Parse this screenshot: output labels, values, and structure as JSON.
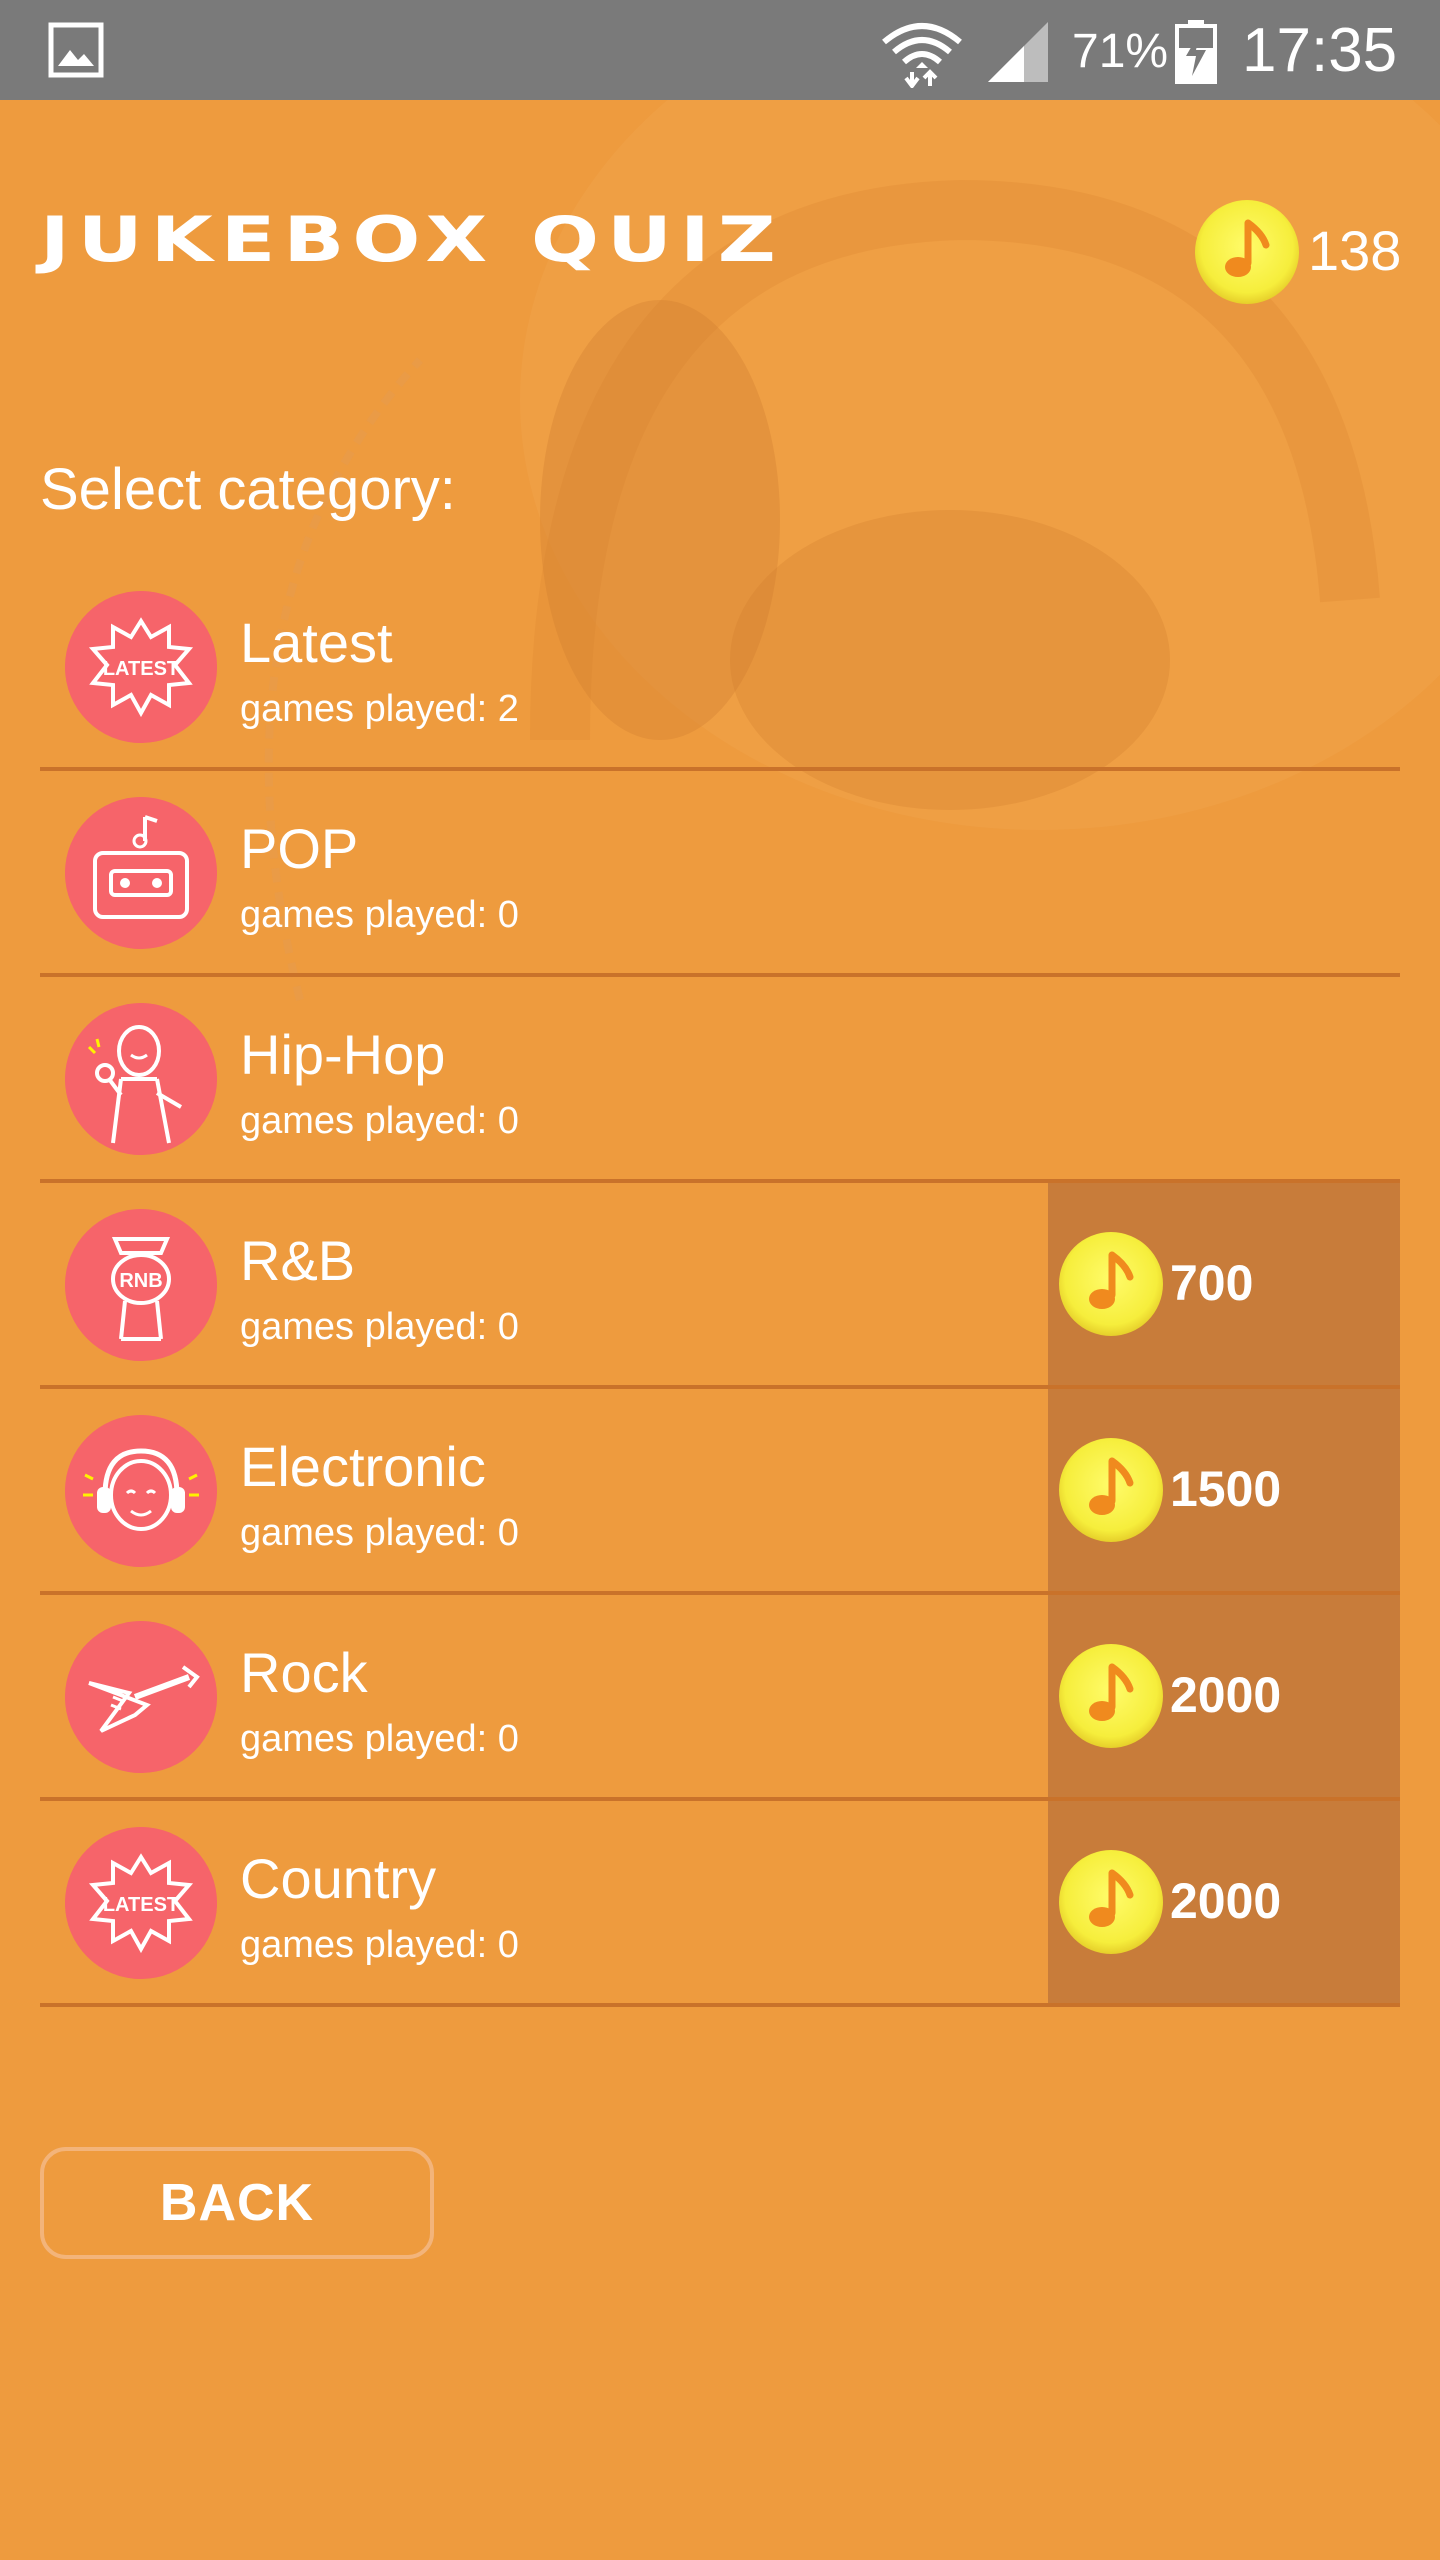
{
  "status_bar": {
    "battery_percent": "71%",
    "time": "17:35",
    "icons": [
      "gallery-icon",
      "wifi-icon",
      "signal-icon",
      "battery-charging-icon"
    ]
  },
  "header": {
    "title": "JUKEBOX QUIZ",
    "coin_balance": "138",
    "coin_icon": "music-note-coin-icon"
  },
  "section_label": "Select category:",
  "categories": [
    {
      "name": "Latest",
      "played": "games played: 2",
      "icon": "latest-badge-icon",
      "price": null
    },
    {
      "name": "POP",
      "played": "games played: 0",
      "icon": "cassette-icon",
      "price": null
    },
    {
      "name": "Hip-Hop",
      "played": "games played: 0",
      "icon": "rapper-icon",
      "price": null
    },
    {
      "name": "R&B",
      "played": "games played: 0",
      "icon": "rnb-singer-icon",
      "price": "700"
    },
    {
      "name": "Electronic",
      "played": "games played: 0",
      "icon": "dj-headphones-icon",
      "price": "1500"
    },
    {
      "name": "Rock",
      "played": "games played: 0",
      "icon": "electric-guitar-icon",
      "price": "2000"
    },
    {
      "name": "Country",
      "played": "games played: 0",
      "icon": "latest-badge-icon",
      "price": "2000"
    }
  ],
  "back_button": "BACK",
  "colors": {
    "background": "#ee9b3e",
    "icon_circle": "#f6646a",
    "coin": "#f6ee3c",
    "locked_panel": "#c87c3a",
    "status_bar": "#7a7a7a"
  }
}
